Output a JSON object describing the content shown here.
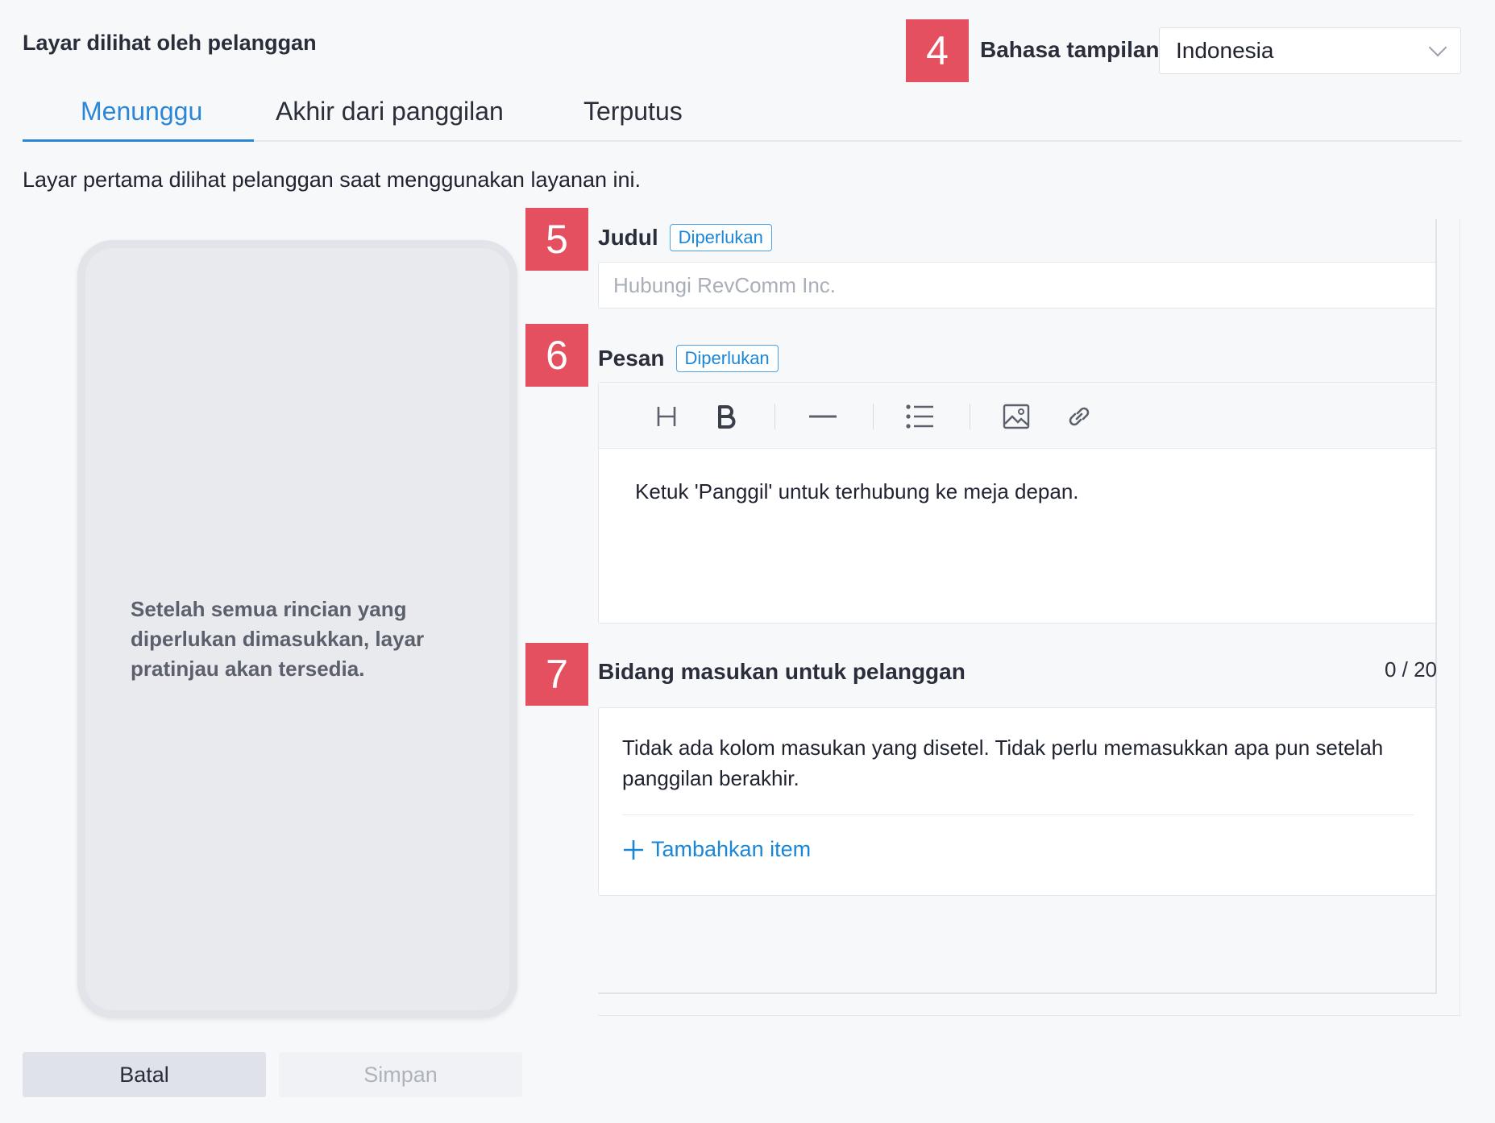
{
  "header": {
    "section_title": "Layar dilihat oleh pelanggan",
    "language_label": "Bahasa tampilan",
    "language_value": "Indonesia"
  },
  "badges": {
    "b4": "4",
    "b5": "5",
    "b6": "6",
    "b7": "7"
  },
  "tabs": [
    {
      "label": "Menunggu",
      "active": true
    },
    {
      "label": "Akhir dari panggilan",
      "active": false
    },
    {
      "label": "Terputus",
      "active": false
    }
  ],
  "description": "Layar pertama dilihat pelanggan saat menggunakan layanan ini.",
  "preview": {
    "message": "Setelah semua rincian yang diperlukan dimasukkan, layar pratinjau akan tersedia."
  },
  "fields": {
    "title": {
      "label": "Judul",
      "required": "Diperlukan",
      "placeholder": "Hubungi RevComm Inc."
    },
    "message": {
      "label": "Pesan",
      "required": "Diperlukan",
      "content": "Ketuk 'Panggil' untuk terhubung ke meja depan."
    },
    "customer_input": {
      "label": "Bidang masukan untuk pelanggan",
      "count": "0 / 20",
      "empty_text": "Tidak ada kolom masukan yang disetel. Tidak perlu memasukkan apa pun setelah panggilan berakhir.",
      "add_item": "Tambahkan item"
    }
  },
  "toolbar": {
    "icons": [
      "heading-icon",
      "bold-icon",
      "horizontal-rule-icon",
      "bullet-list-icon",
      "image-icon",
      "link-icon"
    ]
  },
  "buttons": {
    "cancel": "Batal",
    "save": "Simpan"
  },
  "colors": {
    "accent": "#2b86d6",
    "badge": "#e4505f",
    "required": "#1a86d8"
  }
}
